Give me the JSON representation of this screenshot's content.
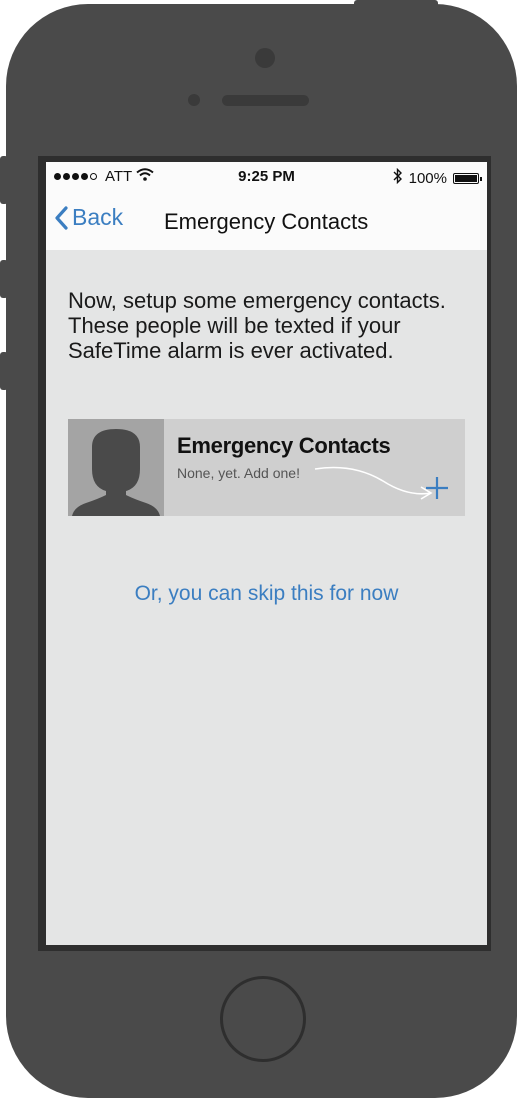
{
  "status_bar": {
    "signal_icon": "signal-dots-icon",
    "carrier": "ATT",
    "wifi_icon": "wifi-icon",
    "time": "9:25 PM",
    "bluetooth_icon": "bluetooth-icon",
    "battery_percent": "100%",
    "battery_icon": "battery-icon",
    "battery_level": 1.0
  },
  "nav": {
    "back_label": "Back",
    "back_icon": "chevron-left-icon",
    "title": "Emergency Contacts"
  },
  "main": {
    "intro": "Now, setup some emergency contacts. These people will be texted if your SafeTime alarm is ever activated.",
    "card": {
      "title": "Emergency Contacts",
      "subtitle": "None, yet. Add one!",
      "avatar_icon": "person-silhouette-icon",
      "add_icon": "plus-icon"
    },
    "skip_label": "Or, you can skip this for now"
  },
  "colors": {
    "accent": "#3b7ec1",
    "phone_body": "#4a4a4a",
    "screen_bg": "#e4e5e5",
    "card_bg": "#cfcfcf",
    "avatar_bg": "#a4a4a4"
  }
}
